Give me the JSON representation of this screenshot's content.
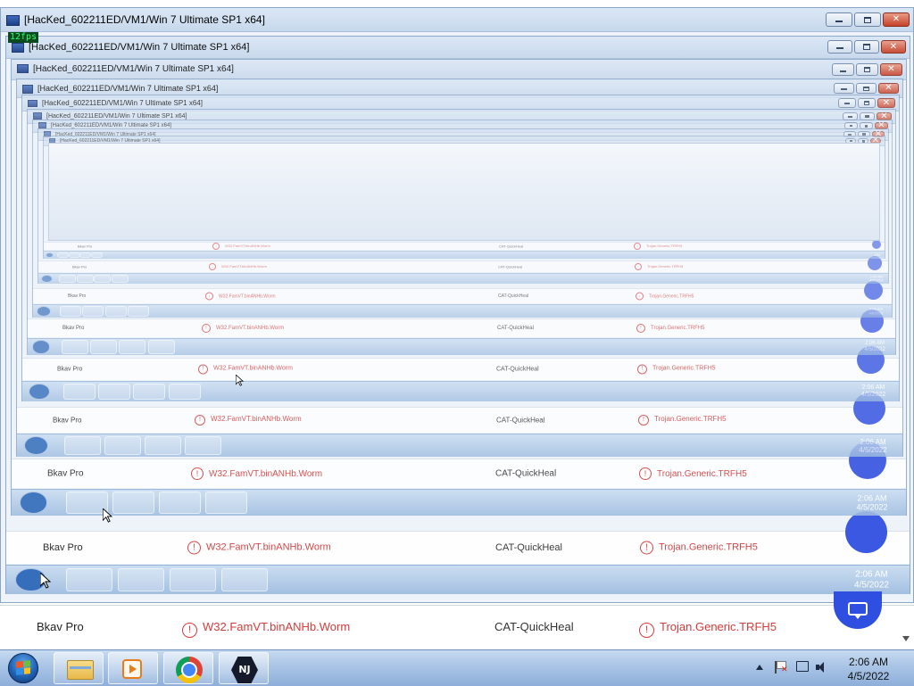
{
  "window": {
    "title": "[HacKed_602211ED/VM1/Win 7 Ultimate SP1 x64]",
    "controls": [
      "minimize",
      "maximize",
      "close"
    ]
  },
  "overlay": {
    "fps": "12fps"
  },
  "result_row": {
    "engine": "Bkav Pro",
    "detection_1": "W32.FamVT.binANHb.Worm",
    "vendor": "CAT-QuickHeal",
    "detection_2": "Trojan.Generic.TRFH5",
    "alert_glyph": "!"
  },
  "chat_button": {
    "icon": "chat-bubble-icon",
    "color": "#2f4fe0"
  },
  "taskbar": {
    "apps": [
      {
        "name": "windows-explorer",
        "icon": "folder-icon"
      },
      {
        "name": "windows-media-player",
        "icon": "media-player-icon"
      },
      {
        "name": "google-chrome",
        "icon": "chrome-icon"
      },
      {
        "name": "nj-rat",
        "icon": "nj-icon",
        "label": "NJ"
      }
    ],
    "clock": {
      "time": "2:06 AM",
      "date": "4/5/2022"
    }
  },
  "colors": {
    "alert_red": "#d33c3c",
    "taskbar_blue": "#a9c4e6"
  }
}
